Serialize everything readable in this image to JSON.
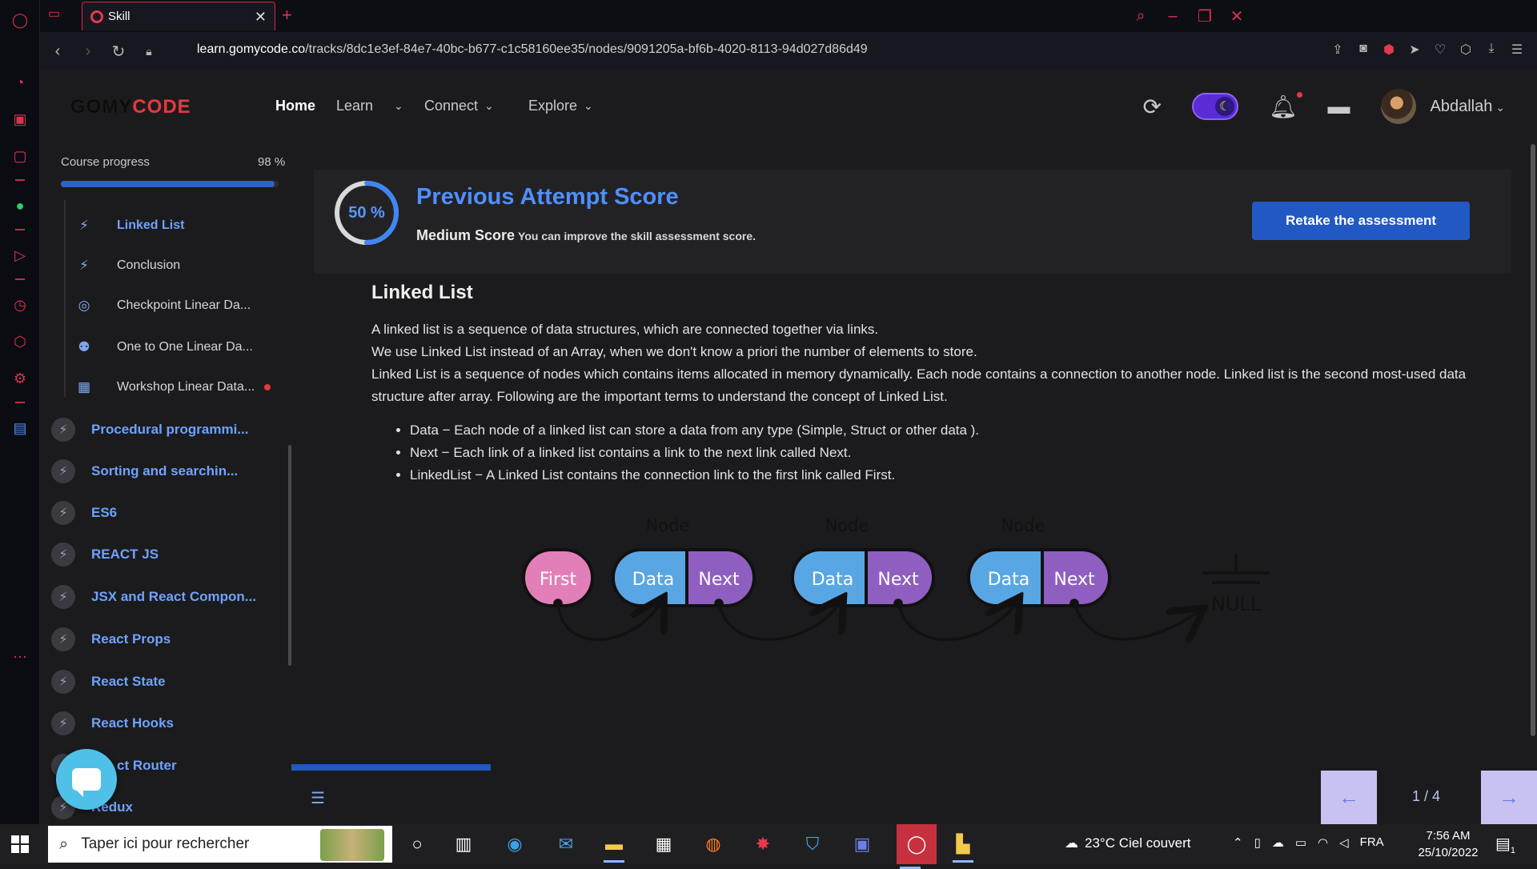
{
  "browser": {
    "tab_title": "Skill",
    "url_domain": "learn.gomycode.co",
    "url_path": "/tracks/8dc1e3ef-84e7-40bc-b677-c1c58160ee35/nodes/9091205a-bf6b-4020-8113-94d027d86d49"
  },
  "header": {
    "logo_a": "GOMY",
    "logo_b": "CODE",
    "nav": [
      {
        "label": "Home"
      },
      {
        "label": "Learn"
      },
      {
        "label": "Connect"
      },
      {
        "label": "Explore"
      }
    ],
    "user_name": "Abdallah"
  },
  "sidebar": {
    "progress_label": "Course progress",
    "progress_text": "98 %",
    "progress_value": 0.98,
    "sub_items": [
      {
        "label": "Linked List",
        "icon": "bolt-icon"
      },
      {
        "label": "Conclusion",
        "icon": "bolt-icon"
      },
      {
        "label": "Checkpoint Linear Da...",
        "icon": "target-icon"
      },
      {
        "label": "One to One Linear Da...",
        "icon": "people-icon"
      },
      {
        "label": "Workshop Linear Data...",
        "icon": "workshop-icon"
      }
    ],
    "chapters": [
      {
        "label": "Procedural programmi..."
      },
      {
        "label": "Sorting and searchin..."
      },
      {
        "label": "ES6"
      },
      {
        "label": "REACT JS"
      },
      {
        "label": "JSX and React Compon..."
      },
      {
        "label": "React Props"
      },
      {
        "label": "React State"
      },
      {
        "label": "React Hooks"
      },
      {
        "label": "ct Router"
      },
      {
        "label": "Redux"
      }
    ]
  },
  "score": {
    "percent_text": "50 %",
    "percent_value": 0.5,
    "title": "Previous Attempt Score",
    "level": "Medium Score",
    "hint": "You can improve the skill assessment score.",
    "retake_label": "Retake the assessment"
  },
  "lesson": {
    "title": "Linked List",
    "paragraphs": [
      "A linked list is a sequence of data structures, which are connected together via links.",
      "We use Linked List instead of an Array, when we don't know a priori the number of elements to store.",
      "Linked List is a sequence of nodes which contains items allocated in memory dynamically. Each node contains a connection to another node. Linked list is the second most-used data structure after array. Following are the important terms to understand the concept of Linked List."
    ],
    "bullets": [
      "Data − Each node of a linked list can store a data from any type (Simple, Struct or other data ).",
      "Next − Each link of a linked list contains a link to the next link called Next.",
      "LinkedList − A Linked List contains the connection link to the first link called First."
    ],
    "diagram": {
      "first": "First",
      "node_label": "Node",
      "data": "Data",
      "next": "Next",
      "null": "NULL"
    }
  },
  "pager": {
    "current": "1 / 4",
    "lesson_progress": 0.16
  },
  "taskbar": {
    "search_placeholder": "Taper ici pour rechercher",
    "weather": "23°C  Ciel couvert",
    "lang": "FRA",
    "time": "7:56 AM",
    "date": "25/10/2022",
    "notif_count": "1"
  },
  "colors": {
    "accent": "#2258c4",
    "link": "#6fa2ff",
    "opera_red": "#d8344f",
    "first_node": "#e27fb8",
    "data_cell": "#59a6e4",
    "next_cell": "#8e5fc0"
  }
}
